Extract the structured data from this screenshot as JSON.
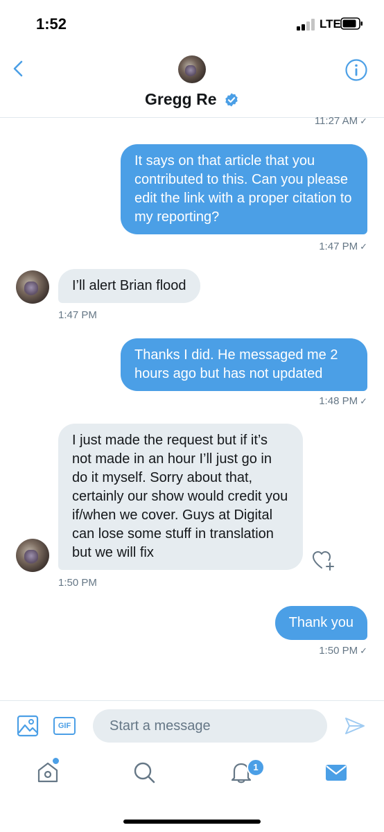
{
  "status_bar": {
    "time": "1:52",
    "network": "LTE"
  },
  "header": {
    "contact_name": "Gregg Re",
    "verified": true
  },
  "conversation": {
    "top_timestamp": "11:27 AM",
    "messages": [
      {
        "direction": "outgoing",
        "text": "It says on that article that you contributed to this. Can you please edit the link with a proper citation to my reporting?",
        "time": "1:47 PM"
      },
      {
        "direction": "incoming",
        "text": "I’ll alert Brian flood",
        "time": "1:47 PM"
      },
      {
        "direction": "outgoing",
        "text": "Thanks I did. He messaged me 2 hours ago but has not updated",
        "time": "1:48 PM"
      },
      {
        "direction": "incoming",
        "text": "I just made the request but if it’s not made in an hour I’ll just go in do it myself. Sorry about that, certainly our show would credit you if/when we cover. Guys at Digital can lose some stuff in translation but we will fix",
        "time": "1:50 PM"
      },
      {
        "direction": "outgoing",
        "text": "Thank you",
        "time": "1:50 PM"
      }
    ],
    "read_mark": "✓"
  },
  "composer": {
    "placeholder": "Start a message",
    "gif_label": "GIF"
  },
  "tab_bar": {
    "notifications_count": "1"
  },
  "colors": {
    "accent": "#4b9fe6",
    "incoming_bubble": "#e6ecf0",
    "muted_text": "#657786"
  },
  "icons": [
    "back-chevron-icon",
    "info-icon",
    "verified-badge-icon",
    "image-icon",
    "gif-icon",
    "send-icon",
    "home-icon",
    "search-icon",
    "notifications-bell-icon",
    "messages-envelope-icon",
    "like-heart-icon"
  ]
}
